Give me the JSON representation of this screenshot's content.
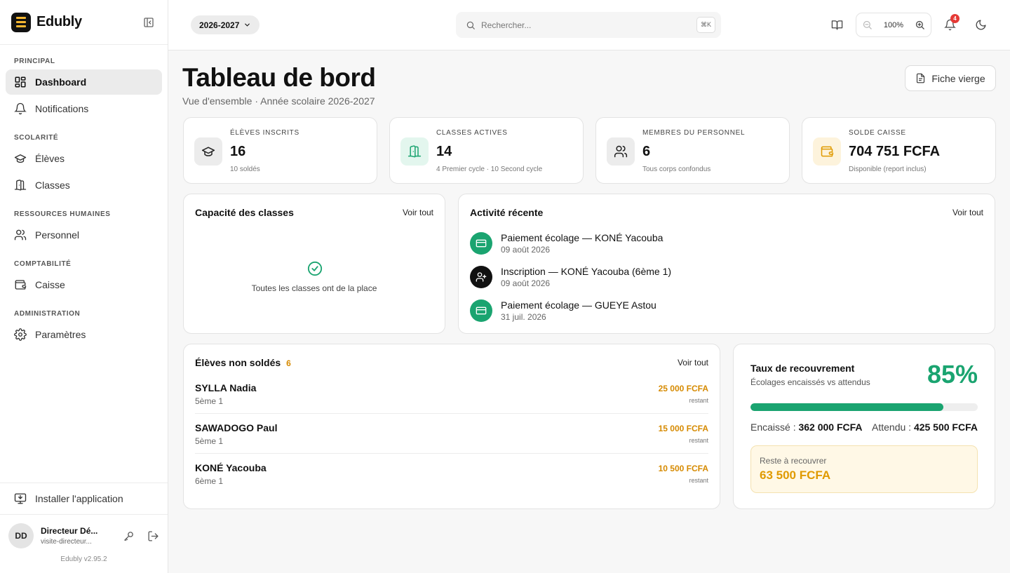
{
  "app": {
    "name": "Edubly",
    "version": "Edubly v2.95.2"
  },
  "sidebar": {
    "sections": [
      {
        "title": "PRINCIPAL",
        "items": [
          {
            "label": "Dashboard",
            "icon": "dashboard-icon",
            "active": true
          },
          {
            "label": "Notifications",
            "icon": "bell-icon"
          }
        ]
      },
      {
        "title": "SCOLARITÉ",
        "items": [
          {
            "label": "Élèves",
            "icon": "graduation-cap-icon"
          },
          {
            "label": "Classes",
            "icon": "door-icon"
          }
        ]
      },
      {
        "title": "RESSOURCES HUMAINES",
        "items": [
          {
            "label": "Personnel",
            "icon": "users-icon"
          }
        ]
      },
      {
        "title": "COMPTABILITÉ",
        "items": [
          {
            "label": "Caisse",
            "icon": "wallet-icon"
          }
        ]
      },
      {
        "title": "ADMINISTRATION",
        "items": [
          {
            "label": "Paramètres",
            "icon": "gear-icon"
          }
        ]
      }
    ],
    "install_label": "Installer l'application",
    "user": {
      "initials": "DD",
      "name": "Directeur Dé...",
      "email": "visite-directeur..."
    }
  },
  "topbar": {
    "year": "2026-2027",
    "search_placeholder": "Rechercher...",
    "search_shortcut": "⌘K",
    "zoom": "100%",
    "notifications_count": "4"
  },
  "header": {
    "title": "Tableau de bord",
    "subtitle": "Vue d'ensemble · Année scolaire 2026-2027",
    "fiche_button": "Fiche vierge"
  },
  "stats": [
    {
      "label": "ÉLÈVES INSCRITS",
      "value": "16",
      "sub": "10 soldés"
    },
    {
      "label": "CLASSES ACTIVES",
      "value": "14",
      "sub": "4 Premier cycle · 10 Second cycle"
    },
    {
      "label": "MEMBRES DU PERSONNEL",
      "value": "6",
      "sub": "Tous corps confondus"
    },
    {
      "label": "SOLDE CAISSE",
      "value": "704 751 FCFA",
      "sub": "Disponible (report inclus)"
    }
  ],
  "capacity": {
    "title": "Capacité des classes",
    "see_all": "Voir tout",
    "empty": "Toutes les classes ont de la place"
  },
  "activity": {
    "title": "Activité récente",
    "see_all": "Voir tout",
    "items": [
      {
        "title": "Paiement écolage — KONÉ Yacouba",
        "date": "09 août 2026"
      },
      {
        "title": "Inscription — KONÉ Yacouba (6ème 1)",
        "date": "09 août 2026"
      },
      {
        "title": "Paiement écolage — GUEYE Astou",
        "date": "31 juil. 2026"
      }
    ]
  },
  "unpaid": {
    "title": "Élèves non soldés",
    "count": "6",
    "see_all": "Voir tout",
    "rows": [
      {
        "name": "SYLLA Nadia",
        "class": "5ème 1",
        "amount": "25 000 FCFA",
        "note": "restant"
      },
      {
        "name": "SAWADOGO Paul",
        "class": "5ème 1",
        "amount": "15 000 FCFA",
        "note": "restant"
      },
      {
        "name": "KONÉ Yacouba",
        "class": "6ème 1",
        "amount": "10 500 FCFA",
        "note": "restant"
      }
    ]
  },
  "recovery": {
    "title": "Taux de recouvrement",
    "subtitle": "Écolages encaissés vs attendus",
    "percent": "85%",
    "progress": 85,
    "collected_label": "Encaissé :",
    "collected": "362 000 FCFA",
    "expected_label": "Attendu :",
    "expected": "425 500 FCFA",
    "remaining_label": "Reste à recouvrer",
    "remaining": "63 500 FCFA"
  },
  "colors": {
    "accent_green": "#1aa470",
    "warning_orange": "#d68a00",
    "badge_red": "#e53935"
  }
}
